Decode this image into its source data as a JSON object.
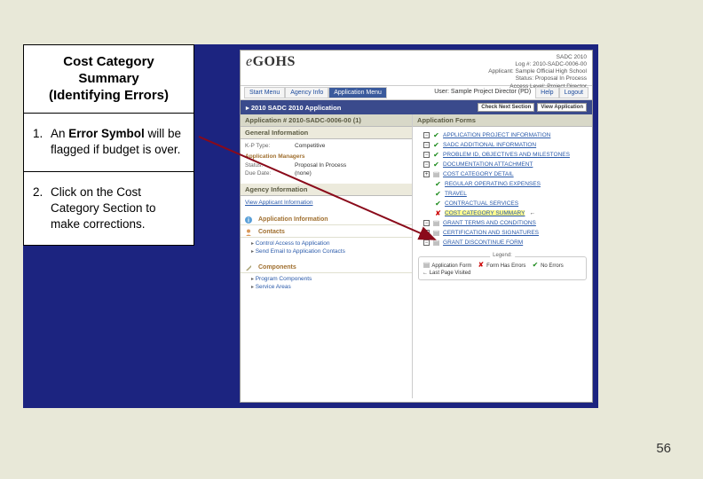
{
  "title_line1": "Cost Category",
  "title_line2": "Summary",
  "title_line3": "(Identifying Errors)",
  "instructions": {
    "item1_prefix": "An ",
    "item1_bold": "Error Symbol",
    "item1_suffix": " will be flagged if budget is over.",
    "item2": "Click on the Cost Category Section to make corrections."
  },
  "page_number": "56",
  "app": {
    "logo_e": "e",
    "logo_text": "GOHS",
    "meta_line1": "SADC 2010",
    "meta_line2": "Log #: 2010-SADC-0006-00",
    "meta_line3": "Applicant: Sample Official High School",
    "meta_line4": "Status: Proposal In Process",
    "meta_line5": "Access Level: Project Director",
    "nav": {
      "start": "Start Menu",
      "agency": "Agency Info",
      "appmenu": "Application Menu",
      "user": "User: Sample Project Director (PD)",
      "help": "Help",
      "logout": "Logout"
    },
    "bar": {
      "title": "2010 SADC 2010 Application",
      "btn1": "Check Next Section",
      "btn2": "View Application"
    },
    "left": {
      "app_header": "Application # 2010-SADC-0006-00 (1)",
      "general_hdr": "General Information",
      "type_lbl": "K-P Type:",
      "type_val": "Competitive",
      "appmgr_hdr": "Application Managers",
      "status_lbl": "Status:",
      "status_val": "Proposal In Process",
      "due_lbl": "Due Date:",
      "due_val": "(none)",
      "agency_hdr": "Agency Information",
      "agency_link": "View Applicant Information",
      "appinfo_hdr": "Application Information",
      "contacts_hdr": "Contacts",
      "contacts_i1": "Control Access to Application",
      "contacts_i2": "Send Email to Application Contacts",
      "components_hdr": "Components",
      "components_i1": "Program Components",
      "components_i2": "Service Areas"
    },
    "right": {
      "forms_hdr": "Application Forms",
      "items": {
        "i1": "APPLICATION PROJECT INFORMATION",
        "i2": "SADC ADDITIONAL INFORMATION",
        "i3": "PROBLEM ID, OBJECTIVES AND MILESTONES",
        "i4": "DOCUMENTATION ATTACHMENT",
        "i5": "COST CATEGORY DETAIL",
        "i5a": "REGULAR OPERATING EXPENSES",
        "i5b": "TRAVEL",
        "i5c": "CONTRACTUAL SERVICES",
        "i5d": "COST CATEGORY SUMMARY",
        "i6": "GRANT TERMS AND CONDITIONS",
        "i7": "CERTIFICATION AND SIGNATURES",
        "i8": "GRANT DISCONTINUE FORM"
      },
      "legend": {
        "title": "Legend:",
        "l1": "Application Form",
        "l2": "Form Has Errors",
        "l3": "No Errors",
        "l4": "Last Page Visited"
      }
    }
  }
}
